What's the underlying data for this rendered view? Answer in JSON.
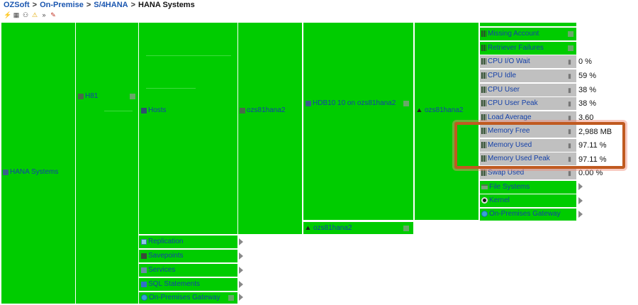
{
  "breadcrumb": [
    "OZSoft",
    "On-Premise",
    "S/4HANA",
    "HANA Systems"
  ],
  "breadcrumb_sep": ">",
  "toolbar": {
    "icons": [
      "refresh-icon",
      "hierarchy-icon",
      "users-icon",
      "warning-icon",
      "fast-forward-icon",
      "pin-icon"
    ]
  },
  "tree": {
    "root": "HANA Systems",
    "system": "H81",
    "hosts": "Hosts",
    "host": "ozs81hana2",
    "database": "HDB10 10 on ozs81hana2",
    "linux_host": "ozs81hana2",
    "linux_host_2": "ozs81hana2",
    "groups": [
      "Replication",
      "Savepoints",
      "Services",
      "SQL Statements",
      "On-Premises Gateway"
    ]
  },
  "metrics": [
    {
      "name": "Missing Account",
      "value": ""
    },
    {
      "name": "Retriever Failures",
      "value": ""
    },
    {
      "name": "CPU I/O Wait",
      "value": "0 %"
    },
    {
      "name": "CPU Idle",
      "value": "59 %"
    },
    {
      "name": "CPU User",
      "value": "38 %"
    },
    {
      "name": "CPU User Peak",
      "value": "38 %"
    },
    {
      "name": "Load Average",
      "value": "3.60"
    },
    {
      "name": "Memory Free",
      "value": "2,988 MB"
    },
    {
      "name": "Memory Used",
      "value": "97.11 %"
    },
    {
      "name": "Memory Used Peak",
      "value": "97.11 %"
    },
    {
      "name": "Swap Used",
      "value": "0.00 %"
    }
  ],
  "host_groups": [
    "File Systems",
    "Kernel",
    "On-Premises Gateway"
  ],
  "colors": {
    "ok": "#00cc00",
    "neutral": "#c0c0c0",
    "highlight": "#c05a20",
    "link": "#1a56b0"
  }
}
